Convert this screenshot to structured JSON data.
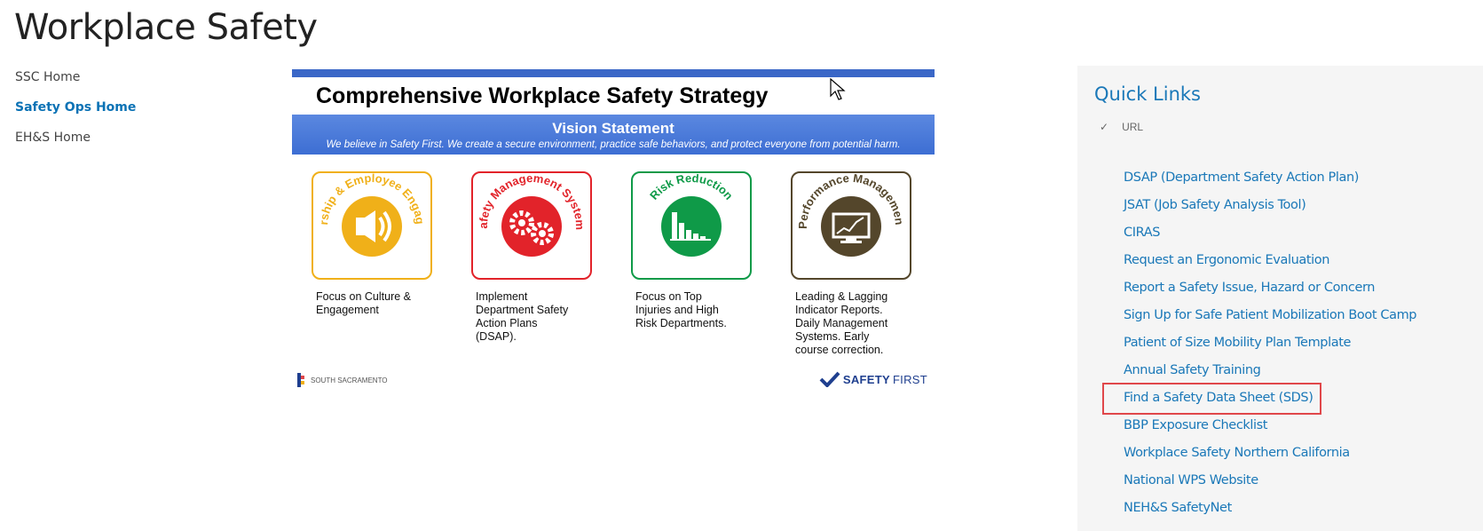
{
  "page": {
    "title": "Workplace Safety"
  },
  "leftnav": {
    "items": [
      {
        "label": "SSC Home",
        "active": false
      },
      {
        "label": "Safety Ops Home",
        "active": true
      },
      {
        "label": "EH&S Home",
        "active": false
      }
    ]
  },
  "banner": {
    "headline": "Comprehensive Workplace Safety Strategy",
    "vision_title": "Vision Statement",
    "vision_text": "We believe in Safety First. We create a secure environment, practice safe behaviors, and protect everyone from potential harm.",
    "tiles": [
      {
        "name": "Leadership & Employee Engagement",
        "color": "#f0b019",
        "caption": "Focus on Culture &\nEngagement"
      },
      {
        "name": "Safety Management Systems",
        "color": "#e2232a",
        "caption": "Implement\nDepartment Safety\nAction Plans\n(DSAP)."
      },
      {
        "name": "Risk Reduction",
        "color": "#0f9a48",
        "caption": "Focus on Top\nInjuries and High\nRisk Departments."
      },
      {
        "name": "Performance Management",
        "color": "#54462b",
        "caption": "Leading & Lagging\nIndicator Reports.\nDaily Management\nSystems. Early\ncourse correction."
      }
    ],
    "logo_left": "SOUTH SACRAMENTO",
    "logo_right_a": "SAFETY",
    "logo_right_b": "FIRST"
  },
  "quick_links": {
    "title": "Quick Links",
    "column_header": "URL",
    "links": [
      "DSAP (Department Safety Action Plan)",
      "JSAT (Job Safety Analysis Tool)",
      "CIRAS",
      "Request an Ergonomic Evaluation",
      "Report a Safety Issue, Hazard or Concern",
      "Sign Up for Safe Patient Mobilization Boot Camp",
      "Patient of Size Mobility Plan Template",
      "Annual Safety Training",
      "Find a Safety Data Sheet (SDS)",
      "BBP Exposure Checklist",
      "Workplace Safety Northern California",
      "National WPS Website",
      "NEH&S SafetyNet"
    ]
  },
  "colors": {
    "accent": "#1a78b8",
    "highlight": "#e0474a",
    "banner_blue": "#3a67c7"
  }
}
